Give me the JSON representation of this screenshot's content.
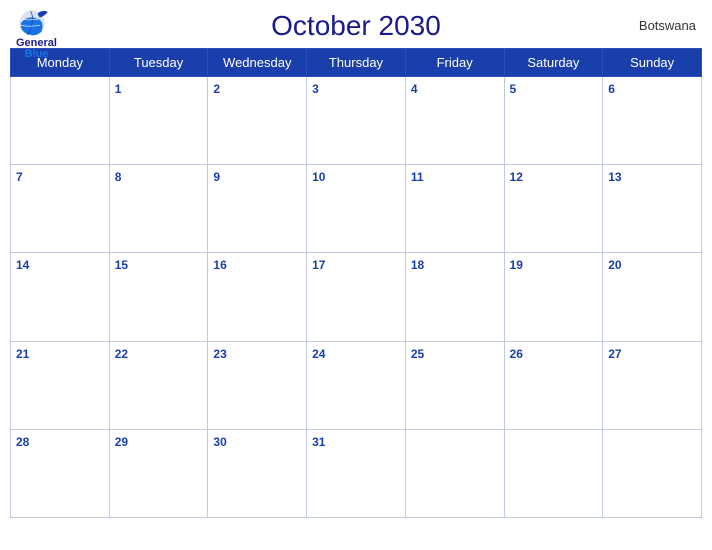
{
  "header": {
    "logo_general": "General",
    "logo_blue": "Blue",
    "title": "October 2030",
    "country": "Botswana"
  },
  "days_of_week": [
    "Monday",
    "Tuesday",
    "Wednesday",
    "Thursday",
    "Friday",
    "Saturday",
    "Sunday"
  ],
  "weeks": [
    [
      null,
      1,
      2,
      3,
      4,
      5,
      6
    ],
    [
      7,
      8,
      9,
      10,
      11,
      12,
      13
    ],
    [
      14,
      15,
      16,
      17,
      18,
      19,
      20
    ],
    [
      21,
      22,
      23,
      24,
      25,
      26,
      27
    ],
    [
      28,
      29,
      30,
      31,
      null,
      null,
      null
    ]
  ]
}
